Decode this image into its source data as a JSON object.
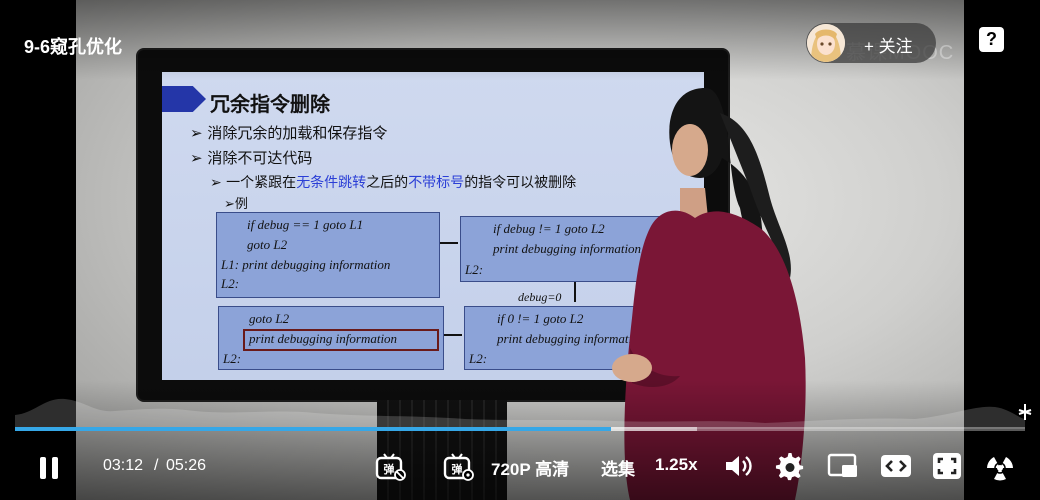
{
  "header": {
    "title": "9-6窥孔优化",
    "follow_label": "+ 关注",
    "watermark": "慕课MOOC",
    "help_label": "?"
  },
  "slide": {
    "title": "冗余指令删除",
    "bullets": [
      "➢ 消除冗余的加载和保存指令",
      "➢ 消除不可达代码"
    ],
    "sub_bullet_prefix": "➢ 一个紧跟在",
    "sub_bullet_hl1": "无条件跳转",
    "sub_bullet_mid": "之后的",
    "sub_bullet_hl2": "不带标号",
    "sub_bullet_suffix": "的指令可以被删除",
    "example_label": "➢例",
    "box1": [
      "if debug == 1 goto L1",
      "goto L2",
      "L1: print debugging information",
      "L2:"
    ],
    "box2": [
      "if debug != 1 goto L2",
      "print debugging information",
      "L2:"
    ],
    "box3": [
      "goto L2",
      "print debugging information",
      "L2:"
    ],
    "box4": [
      "if 0 != 1 goto L2",
      "print debugging information",
      "L2:"
    ],
    "debug_label": "debug=0"
  },
  "controls": {
    "current_time": "03:12",
    "separator": "/",
    "duration": "05:26",
    "quality_label": "720P 高清",
    "episodes_label": "选集",
    "speed_label": "1.25x",
    "progress_fraction": 0.59,
    "buffered_fraction": 0.675,
    "accent_color": "#36a7e7"
  }
}
